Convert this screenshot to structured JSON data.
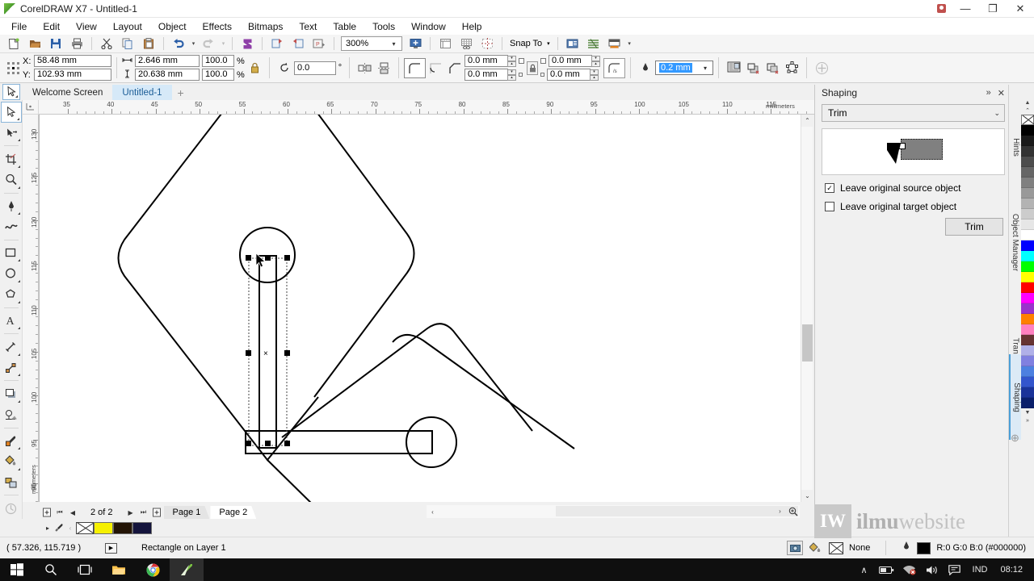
{
  "window": {
    "title": "CorelDRAW X7 - Untitled-1",
    "logo_icon": "coreldraw-logo-icon",
    "user_icon": "user-account-icon",
    "minimize_label": "—",
    "restore_label": "❐",
    "close_label": "✕"
  },
  "menubar": {
    "items": [
      {
        "label": "File"
      },
      {
        "label": "Edit"
      },
      {
        "label": "View"
      },
      {
        "label": "Layout"
      },
      {
        "label": "Object"
      },
      {
        "label": "Effects"
      },
      {
        "label": "Bitmaps"
      },
      {
        "label": "Text"
      },
      {
        "label": "Table"
      },
      {
        "label": "Tools"
      },
      {
        "label": "Window"
      },
      {
        "label": "Help"
      }
    ]
  },
  "toolbar": {
    "icons": [
      {
        "name": "new-document-icon"
      },
      {
        "name": "open-document-icon"
      },
      {
        "name": "save-document-icon"
      },
      {
        "name": "print-icon"
      },
      {
        "name": "cut-icon"
      },
      {
        "name": "copy-icon"
      },
      {
        "name": "paste-icon"
      },
      {
        "name": "undo-icon"
      },
      {
        "name": "redo-icon"
      },
      {
        "name": "corel-connect-icon"
      },
      {
        "name": "import-icon"
      },
      {
        "name": "export-icon"
      },
      {
        "name": "publish-pdf-icon"
      }
    ],
    "zoom_level": "300%",
    "zoom_dropdown_icon": "chevron-down-icon",
    "fullscreen_icon": "full-screen-preview-icon",
    "show_rulers_icon": "show-rulers-icon",
    "show_grid_icon": "show-grid-icon",
    "show_guides_icon": "show-guides-icon",
    "snap_to_label": "Snap To",
    "options_icon": "options-icon",
    "layout_icon": "document-layout-icon",
    "display_icon": "display-mode-icon"
  },
  "propertybar": {
    "position_icon": "object-origin-icon",
    "x_label": "X:",
    "x_value": "58.48 mm",
    "y_label": "Y:",
    "y_value": "102.93 mm",
    "width_icon": "object-width-icon",
    "width_value": "2.646 mm",
    "height_icon": "object-height-icon",
    "height_value": "20.638 mm",
    "scale_x": "100.0",
    "scale_y": "100.0",
    "percent_label": "%",
    "lock_ratio_icon": "lock-ratio-icon",
    "rotate_icon": "rotation-angle-icon",
    "rotation_value": "0.0",
    "degree_label": "°",
    "mirror_h_icon": "mirror-horizontal-icon",
    "mirror_v_icon": "mirror-vertical-icon",
    "corner_round_icon": "round-corner-icon",
    "corner_scallop_icon": "scalloped-corner-icon",
    "corner_chamfer_icon": "chamfered-corner-icon",
    "corner_tl": "0.0 mm",
    "corner_bl": "0.0 mm",
    "corner_tr": "0.0 mm",
    "corner_br": "0.0 mm",
    "edit_corners_lock_icon": "lock-corners-icon",
    "relative_corner_icon": "relative-corner-scaling-icon",
    "outline_width_icon": "outline-width-icon",
    "outline_width_value": "0.2 mm",
    "outline_dropdown_icon": "chevron-down-icon",
    "text_wrap_icon": "wrap-paragraph-text-icon",
    "to_front_icon": "to-front-of-layer-icon",
    "to_back_icon": "to-back-of-layer-icon",
    "convert_to_curves_icon": "convert-to-curves-icon",
    "add_node_icon": "add-node-icon"
  },
  "doctabs": {
    "pick_tool_icon": "pick-tool-icon",
    "tabs": [
      {
        "label": "Welcome Screen",
        "active": false
      },
      {
        "label": "Untitled-1",
        "active": true
      }
    ],
    "add_tab_label": "+"
  },
  "toolbox": {
    "tools": [
      {
        "name": "pick-tool-icon",
        "glyph": "⬉",
        "selected": true
      },
      {
        "name": "shape-tool-icon",
        "glyph": "➤",
        "selected": false
      },
      {
        "name": "crop-tool-icon",
        "glyph": "✂",
        "selected": false
      },
      {
        "name": "zoom-tool-icon",
        "glyph": "⚲",
        "selected": false
      },
      {
        "name": "freehand-tool-icon",
        "glyph": "✎",
        "selected": false
      },
      {
        "name": "artistic-media-tool-icon",
        "glyph": "∿",
        "selected": false
      },
      {
        "name": "rectangle-tool-icon",
        "glyph": "▭",
        "selected": false
      },
      {
        "name": "ellipse-tool-icon",
        "glyph": "○",
        "selected": false
      },
      {
        "name": "polygon-tool-icon",
        "glyph": "⬡",
        "selected": false
      },
      {
        "name": "text-tool-icon",
        "glyph": "A",
        "selected": false
      },
      {
        "name": "parallel-dimension-tool-icon",
        "glyph": "⤡",
        "selected": false
      },
      {
        "name": "straight-line-connector-tool-icon",
        "glyph": "↗",
        "selected": false
      },
      {
        "name": "drop-shadow-tool-icon",
        "glyph": "▣",
        "selected": false
      },
      {
        "name": "transparency-tool-icon",
        "glyph": "◑",
        "selected": false
      },
      {
        "name": "color-eyedropper-tool-icon",
        "glyph": "✒",
        "selected": false
      },
      {
        "name": "interactive-fill-tool-icon",
        "glyph": "◆",
        "selected": false
      },
      {
        "name": "smart-fill-tool-icon",
        "glyph": "◩",
        "selected": false
      },
      {
        "name": "outline-tool-icon",
        "glyph": "◌",
        "selected": false
      }
    ]
  },
  "rulers": {
    "unit_label": "millimeters",
    "h_ticks": [
      35,
      40,
      45,
      50,
      55,
      60,
      65,
      70,
      75,
      80,
      85,
      90,
      95,
      100,
      105,
      110,
      115
    ],
    "v_ticks": [
      130,
      125,
      120,
      115,
      110,
      105,
      100,
      95,
      90
    ],
    "origin_icon": "ruler-origin-icon"
  },
  "canvas": {
    "scroll_up_icon": "chevron-up-icon",
    "scroll_down_icon": "chevron-down-icon",
    "scroll_left_icon": "chevron-left-icon",
    "scroll_right_icon": "chevron-right-icon",
    "zoom_to_fit_icon": "zoom-to-page-icon",
    "selection_marker_label": "×",
    "cursor_icon": "pick-cursor-icon"
  },
  "pagenav": {
    "add_page_start_icon": "add-page-before-icon",
    "first_icon": "⏮",
    "prev_icon": "◀",
    "counter": "2 of 2",
    "next_icon": "▶",
    "last_icon": "⏭",
    "add_page_end_icon": "add-page-after-icon",
    "pages": [
      {
        "label": "Page 1",
        "active": false
      },
      {
        "label": "Page 2",
        "active": true
      }
    ]
  },
  "minipalette": {
    "expand_icon": "palette-expand-icon",
    "eyedropper_icon": "eyedropper-icon",
    "prev_icon": "palette-scroll-left-icon",
    "none_swatch_label": "none-swatch",
    "swatches": [
      "#f6f000",
      "#231405",
      "#14143c"
    ]
  },
  "statusbar": {
    "coordinates": "( 57.326, 115.719 )",
    "play_icon": "play-icon",
    "object_info": "Rectangle on Layer 1",
    "fill_icon": "fill-color-icon",
    "fill_swatch_icon": "fill-none-icon",
    "fill_value": "None",
    "outline_icon": "outline-color-icon",
    "outline_value": "R:0 G:0 B:0 (#000000)",
    "snapshot_icon": "snapshot-icon"
  },
  "docker": {
    "title": "Shaping",
    "collapse_icon": "»",
    "close_icon": "✕",
    "operation": "Trim",
    "operation_dropdown_icon": "chevron-down-icon",
    "preview_icon": "trim-preview-icon",
    "checkboxes": [
      {
        "label": "Leave original source object",
        "checked": true
      },
      {
        "label": "Leave original target object",
        "checked": false
      }
    ],
    "action_button": "Trim",
    "tabs": [
      {
        "label": "Hints",
        "icon": "hints-icon",
        "active": false
      },
      {
        "label": "Object Manager",
        "icon": "object-manager-icon",
        "active": false
      },
      {
        "label": "Transformations",
        "icon": "transformations-icon",
        "active": false
      },
      {
        "label": "Shaping",
        "icon": "shaping-icon",
        "active": true
      }
    ],
    "add_docker_icon": "add-docker-icon"
  },
  "palette": {
    "scroll_up_icon": "▲",
    "scroll_down_icon": "▼",
    "expand_icon": "»",
    "none_swatch_label": "no-color-swatch",
    "colors": [
      "#000000",
      "#1a1a1a",
      "#333333",
      "#4d4d4d",
      "#666666",
      "#808080",
      "#999999",
      "#b3b3b3",
      "#cccccc",
      "#e6e6e6",
      "#ffffff",
      "#0000ff",
      "#00ffff",
      "#00ff00",
      "#ffff00",
      "#ff0000",
      "#ff00ff",
      "#9933cc",
      "#ff8000",
      "#ff80c0",
      "#663333",
      "#b0b0e8",
      "#8080e0",
      "#4d80e0",
      "#3355cc",
      "#1a3399",
      "#0a1f6b"
    ]
  },
  "watermark": {
    "mark": "IW",
    "bold_text": "ilmu",
    "light_text": "website"
  },
  "taskbar": {
    "start_icon": "windows-start-icon",
    "search_icon": "search-icon",
    "taskview_icon": "task-view-icon",
    "explorer_icon": "file-explorer-icon",
    "chrome_icon": "chrome-icon",
    "coreldraw_icon": "coreldraw-taskbar-icon",
    "tray_expand_icon": "∧",
    "battery_icon": "battery-icon",
    "network_icon": "network-icon",
    "volume_icon": "volume-icon",
    "action_center_icon": "action-center-icon",
    "language": "IND",
    "clock": "08:12"
  }
}
